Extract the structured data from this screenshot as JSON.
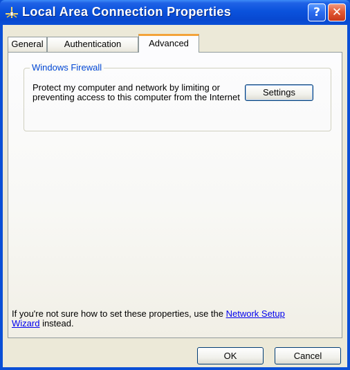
{
  "window": {
    "title": "Local Area Connection Properties",
    "help_label": "?",
    "close_label": "✕"
  },
  "tabs": [
    {
      "label": "General",
      "active": false
    },
    {
      "label": "Authentication",
      "active": false
    },
    {
      "label": "Advanced",
      "active": true
    }
  ],
  "firewall_group": {
    "title": "Windows Firewall",
    "description": "Protect my computer and network by limiting or preventing access to this computer from the Internet",
    "settings_button": "Settings"
  },
  "footer": {
    "text_before_link": "If you're not sure how to set these properties, use the ",
    "link_text": "Network Setup Wizard",
    "text_after_link": " instead."
  },
  "buttons": {
    "ok": "OK",
    "cancel": "Cancel"
  },
  "colors": {
    "titlebar": "#0a4fd6",
    "client_bg": "#ece9d8",
    "active_tab_accent": "#f3a33a",
    "group_title": "#0046d5",
    "link": "#0000ee"
  },
  "icons": {
    "title_icon": "network-connection-icon"
  }
}
